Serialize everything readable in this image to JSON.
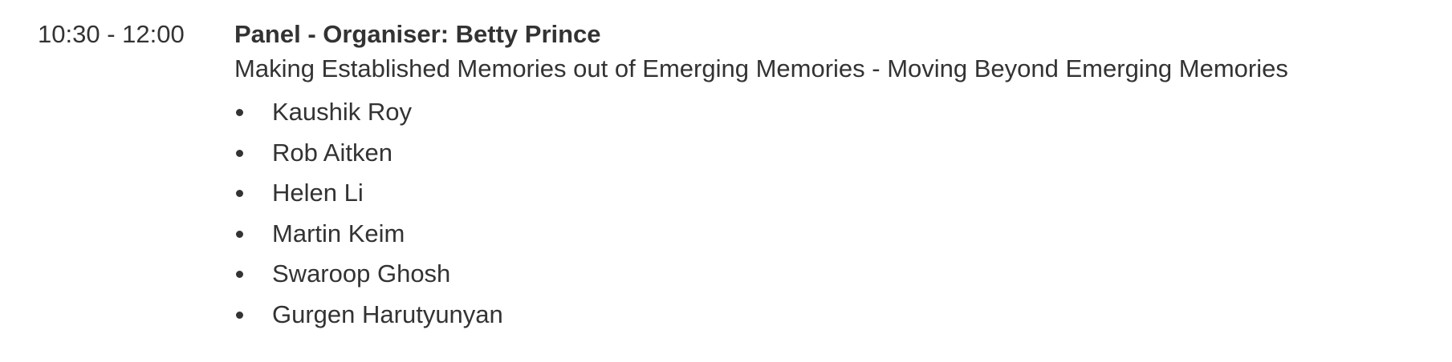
{
  "session": {
    "time": "10:30 - 12:00",
    "title": "Panel - Organiser: Betty Prince",
    "subtitle": "Making Established Memories out of Emerging Memories - Moving Beyond Emerging Memories",
    "speakers": [
      "Kaushik Roy",
      "Rob Aitken",
      "Helen Li",
      "Martin Keim",
      "Swaroop Ghosh",
      "Gurgen Harutyunyan"
    ]
  }
}
